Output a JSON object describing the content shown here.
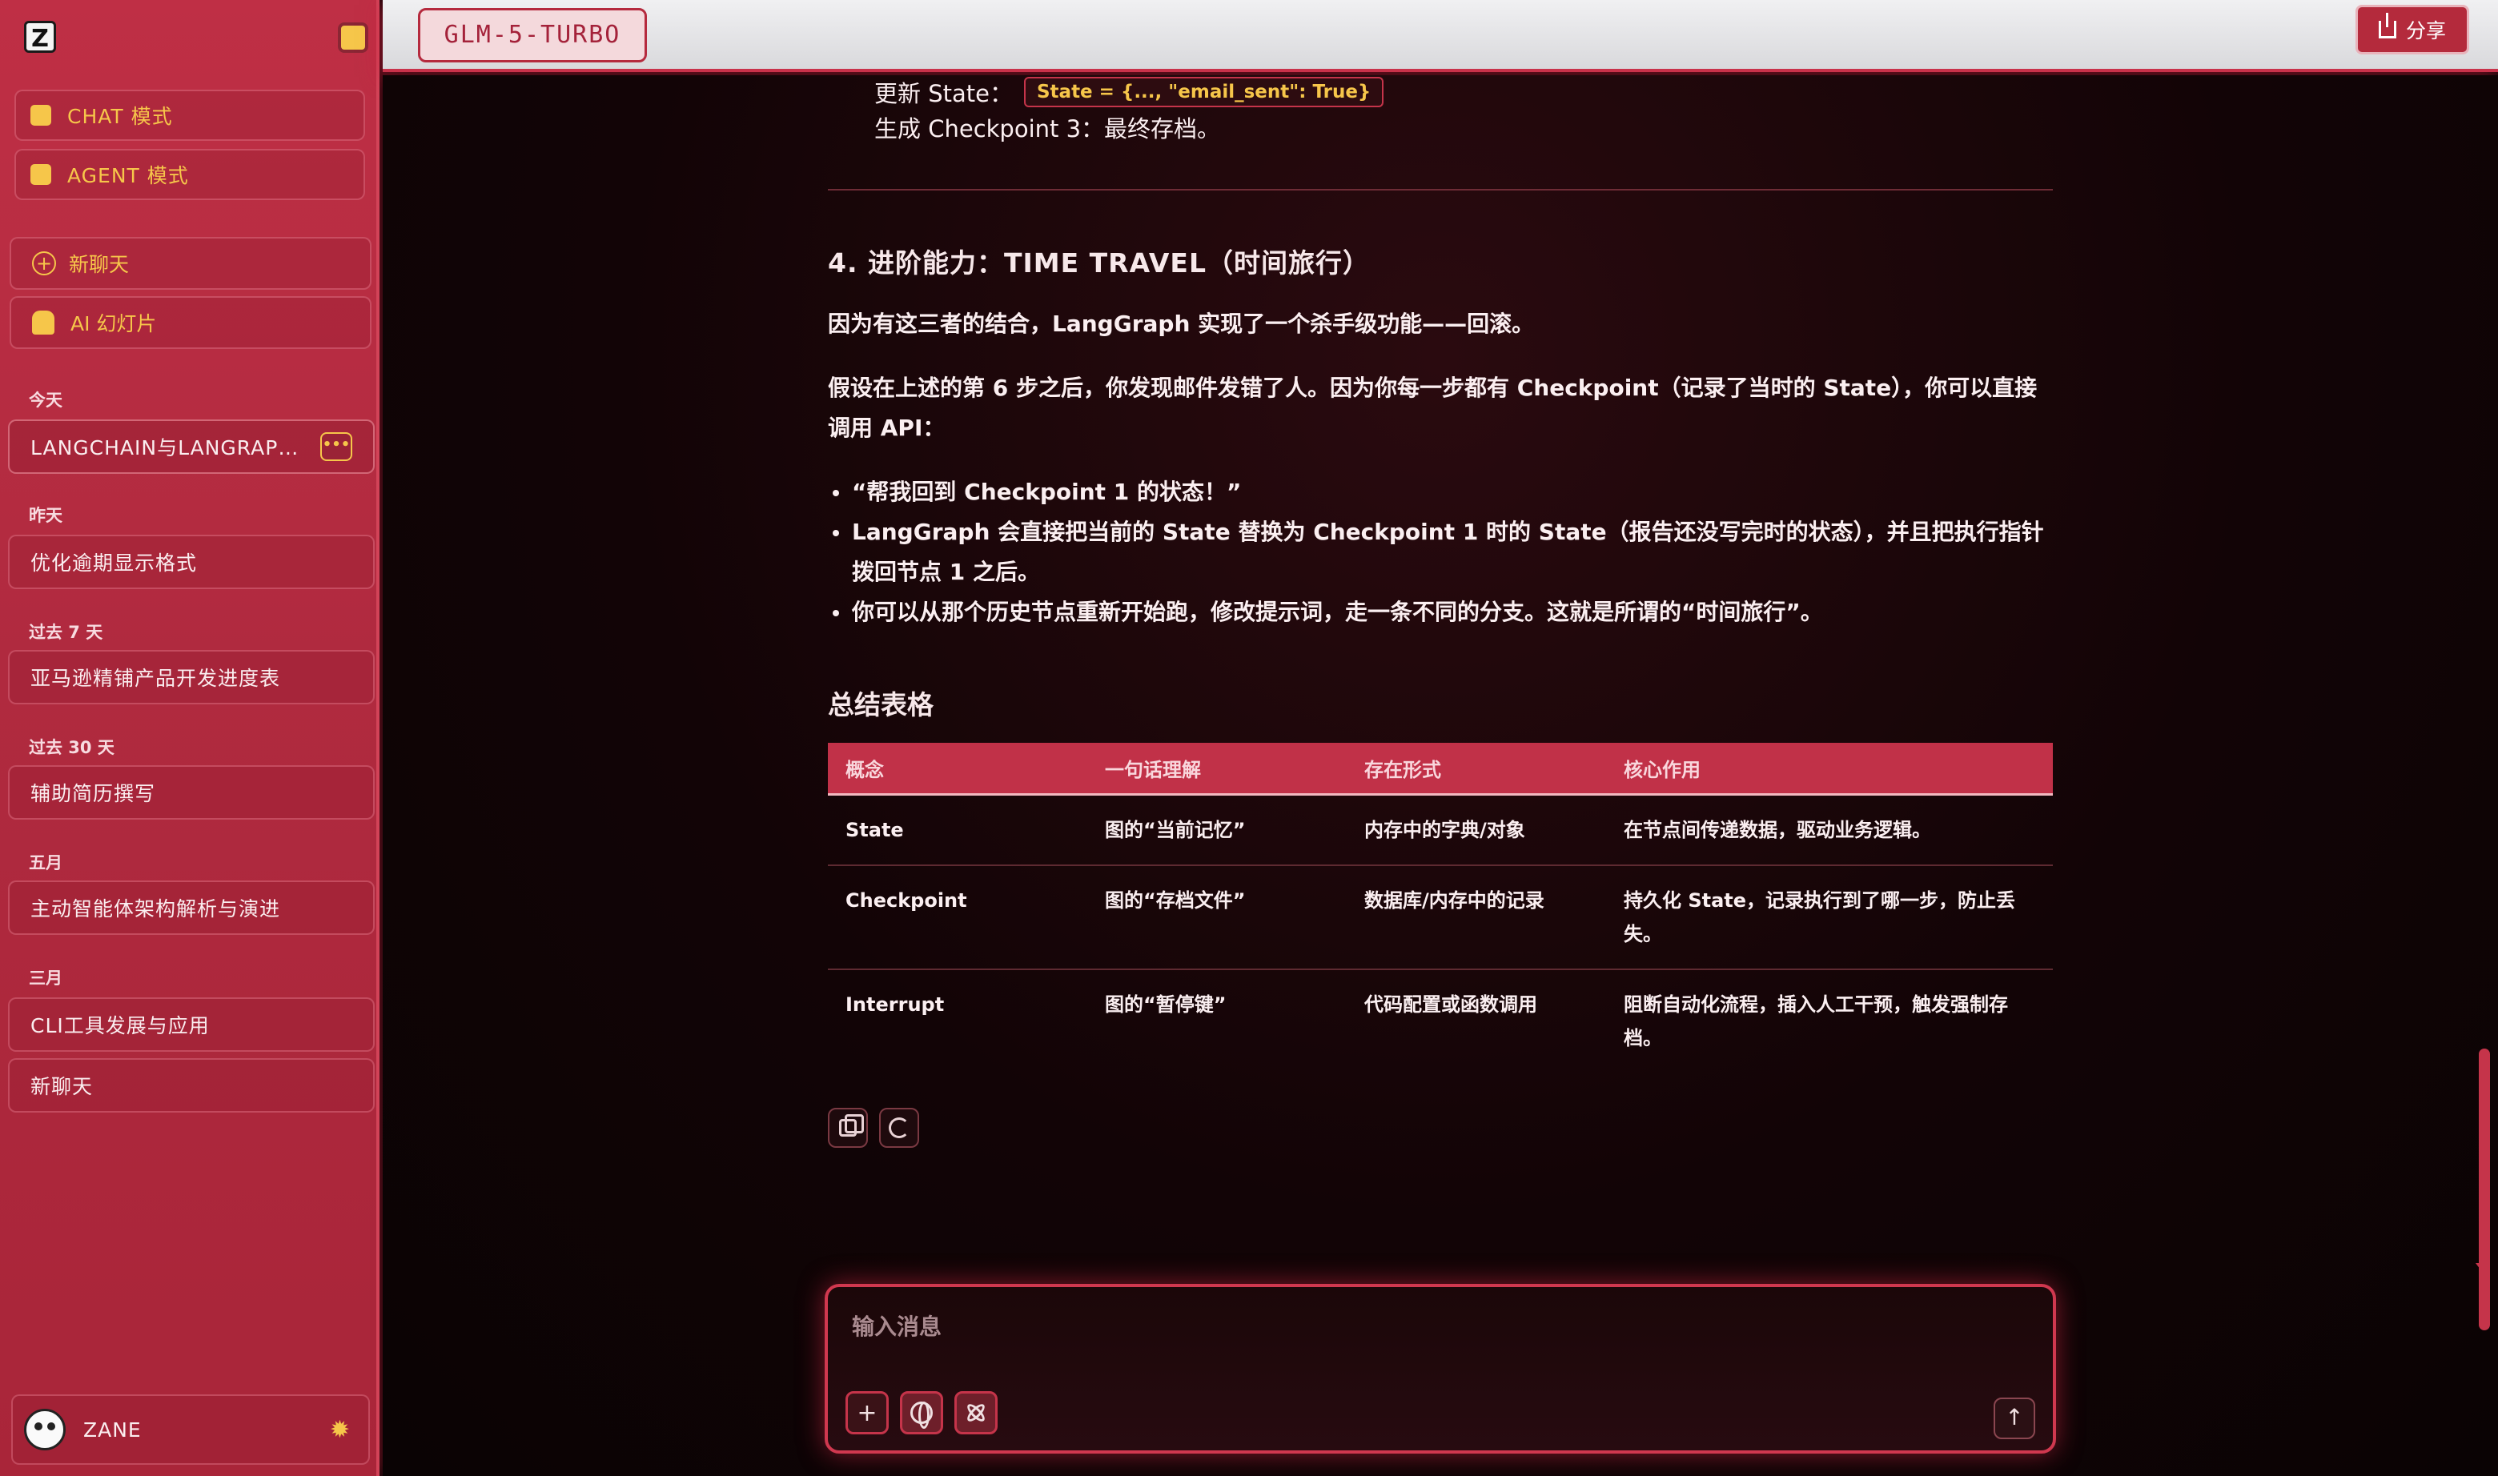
{
  "sidebar": {
    "logo": "Z",
    "modes": [
      {
        "label": "CHAT 模式"
      },
      {
        "label": "AGENT 模式"
      }
    ],
    "actions": {
      "new_chat": "新聊天",
      "ai_slides": "AI 幻灯片"
    },
    "groups": [
      {
        "label": "今天",
        "items": [
          "LANGCHAIN与LANGRAPH..."
        ]
      },
      {
        "label": "昨天",
        "items": [
          "优化逾期显示格式"
        ]
      },
      {
        "label": "过去 7 天",
        "items": [
          "亚马逊精铺产品开发进度表"
        ]
      },
      {
        "label": "过去 30 天",
        "items": [
          "辅助简历撰写"
        ]
      },
      {
        "label": "五月",
        "items": [
          "主动智能体架构解析与演进"
        ]
      },
      {
        "label": "三月",
        "items": [
          "CLI工具发展与应用",
          "新聊天"
        ]
      }
    ],
    "more_label": "•••",
    "user": {
      "name": "ZANE"
    }
  },
  "topbar": {
    "model": "GLM-5-TURBO",
    "share": "分享"
  },
  "content": {
    "state_label": "更新 State：",
    "state_code": "State = {..., \"email_sent\": True}",
    "checkpoint_line": "生成 Checkpoint 3：最终存档。",
    "section4_title": "4. 进阶能力：TIME TRAVEL（时间旅行）",
    "para1": "因为有这三者的结合，LangGraph 实现了一个杀手级功能——回滚。",
    "para2": "假设在上述的第 6 步之后，你发现邮件发错了人。因为你每一步都有 Checkpoint（记录了当时的 State），你可以直接调用 API：",
    "bullets": [
      "“帮我回到 Checkpoint 1 的状态！”",
      "LangGraph 会直接把当前的 State 替换为 Checkpoint 1 时的 State（报告还没写完时的状态），并且把执行指针拨回节点 1 之后。",
      "你可以从那个历史节点重新开始跑，修改提示词，走一条不同的分支。这就是所谓的“时间旅行”。"
    ],
    "table_title": "总结表格",
    "table": {
      "headers": [
        "概念",
        "一句话理解",
        "存在形式",
        "核心作用"
      ],
      "rows": [
        [
          "State",
          "图的“当前记忆”",
          "内存中的字典/对象",
          "在节点间传递数据，驱动业务逻辑。"
        ],
        [
          "Checkpoint",
          "图的“存档文件”",
          "数据库/内存中的记录",
          "持久化 State，记录执行到了哪一步，防止丢失。"
        ],
        [
          "Interrupt",
          "图的“暂停键”",
          "代码配置或函数调用",
          "阻断自动化流程，插入人工干预，触发强制存档。"
        ]
      ]
    }
  },
  "input": {
    "placeholder": "输入消息",
    "plus": "+",
    "send": "↑"
  },
  "colors": {
    "accent": "#c13148",
    "highlight": "#f6c64a",
    "background": "#0d0406"
  }
}
